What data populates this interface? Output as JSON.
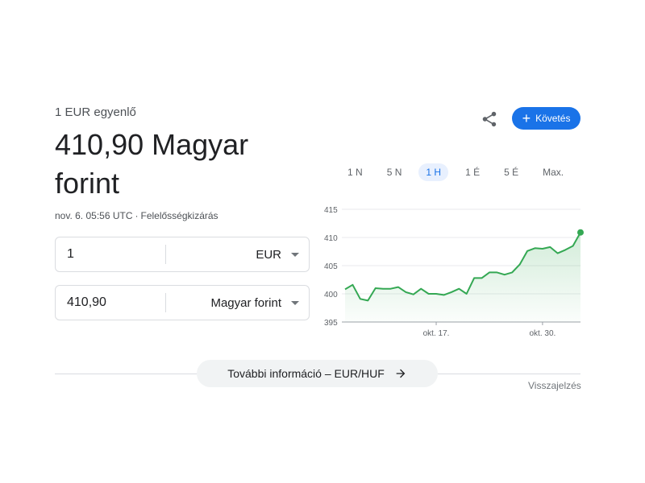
{
  "header": {
    "equal_label": "1 EUR egyenlő",
    "rate_value": "410,90 Magyar forint",
    "timestamp": "nov. 6. 05:56 UTC",
    "separator": "·",
    "disclaimer": "Felelősségkizárás"
  },
  "converter": {
    "from": {
      "amount": "1",
      "currency": "EUR"
    },
    "to": {
      "amount": "410,90",
      "currency": "Magyar forint"
    }
  },
  "actions": {
    "share_icon": "share-icon",
    "follow_label": "Követés",
    "follow_icon": "plus-icon"
  },
  "range_tabs": [
    {
      "label": "1 N",
      "active": false
    },
    {
      "label": "5 N",
      "active": false
    },
    {
      "label": "1 H",
      "active": true
    },
    {
      "label": "1 É",
      "active": false
    },
    {
      "label": "5 É",
      "active": false
    },
    {
      "label": "Max.",
      "active": false
    }
  ],
  "chart_data": {
    "type": "area",
    "title": "",
    "xlabel": "",
    "ylabel": "",
    "ylim": [
      395,
      415
    ],
    "yticks": [
      415,
      410,
      405,
      400,
      395
    ],
    "xtick_labels": [
      {
        "label": "okt. 17.",
        "index": 12
      },
      {
        "label": "okt. 30.",
        "index": 26
      }
    ],
    "values": [
      400.8,
      401.6,
      399.1,
      398.8,
      401.0,
      400.9,
      400.9,
      401.2,
      400.3,
      399.9,
      400.9,
      400.0,
      400.0,
      399.8,
      400.3,
      400.9,
      400.0,
      402.8,
      402.8,
      403.8,
      403.8,
      403.4,
      403.8,
      405.2,
      407.6,
      408.1,
      408.0,
      408.3,
      407.2,
      407.8,
      408.5,
      410.9
    ],
    "grid": true,
    "colors": {
      "line": "#34a853",
      "fill": "#e6f4ea",
      "grid": "#e8eaed",
      "axis": "#9aa0a6"
    }
  },
  "footer": {
    "more_info_label": "További információ – EUR/HUF",
    "feedback_label": "Visszajelzés"
  }
}
